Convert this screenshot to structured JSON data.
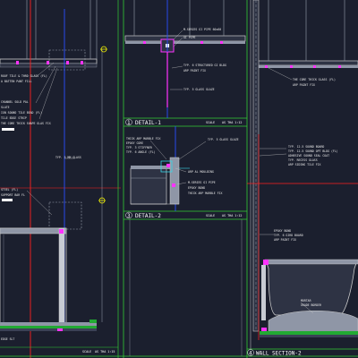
{
  "drawing": {
    "colors": {
      "background": "#1b1f2e",
      "frame": "#33cc33",
      "slab": "#cccccc",
      "section_red": "#ff2020",
      "axis_blue": "#2a4dff",
      "magenta": "#ff33ff",
      "yellow": "#ffff00",
      "cyan": "#39d7e8",
      "grass": "#22aa33"
    },
    "details": [
      {
        "number": "1",
        "title": "DETAIL-1",
        "scale_label": "SCALE",
        "scale_value": "AS THA 1:12"
      },
      {
        "number": "3",
        "title": "DETAIL-2",
        "scale_label": "SCALE",
        "scale_value": "AS THA 1:12"
      },
      {
        "number": "4",
        "title": "WALL SECTION-2",
        "scale_label": "",
        "scale_value": ""
      }
    ],
    "left_scale": {
      "label": "SCALE",
      "value": "AS THA 1:15"
    },
    "notes": {
      "left": [
        "ROOF TILE & THRD GLASS (FL)",
        "A BATTEN PANT FILL",
        "CHANNEL SOLD PAL",
        "SLATE",
        "IGN SOUND TILE BEAD (FL)",
        "TILE EDGE STRIP",
        "THE CORE THICK SHAPE GLAS FIX",
        "TYP. 5 MM GLASS",
        "STEEL (FL)",
        "SUPPORT BAR FL",
        "EDGE SLT"
      ],
      "detail1": [
        "M-SERIES GI PIPE 60x60",
        "GI PIPE",
        "TYP. 6 STRUCTURED GI BLDG",
        "ARP PAINT FIX",
        "TYP. 5 GLASS GLAZE"
      ],
      "detail2": [
        "THICK ARP MARBLE FIX",
        "EPOXY CORE",
        "TYP. 3 STIFFNER",
        "TYP. 6 ANGLE (FL)",
        "TYP. 5 GLASS GLAZE",
        "ARP AL MOULDING",
        "M-SERIES GI PIPE",
        "EPOXY BOND",
        "THICK ARP MARBLE FIX"
      ],
      "right": [
        "THE CORE THICK GLASS (FL)",
        "ARP PAINT FIX",
        "TYP. 12.5 SOUND BOARD",
        "TYP. 12.5 SOUND OPT BLDG (FL)",
        "ADHESIVE SOUND SEAL COAT",
        "TYP. RECESS GLASS",
        "ARP SIDING TILE FIX",
        "EPOXY BOND",
        "TYP. 6 GIRD BOARD",
        "ARP PAINT FIX",
        "MORTAR",
        "GRADE BORDER"
      ]
    }
  }
}
